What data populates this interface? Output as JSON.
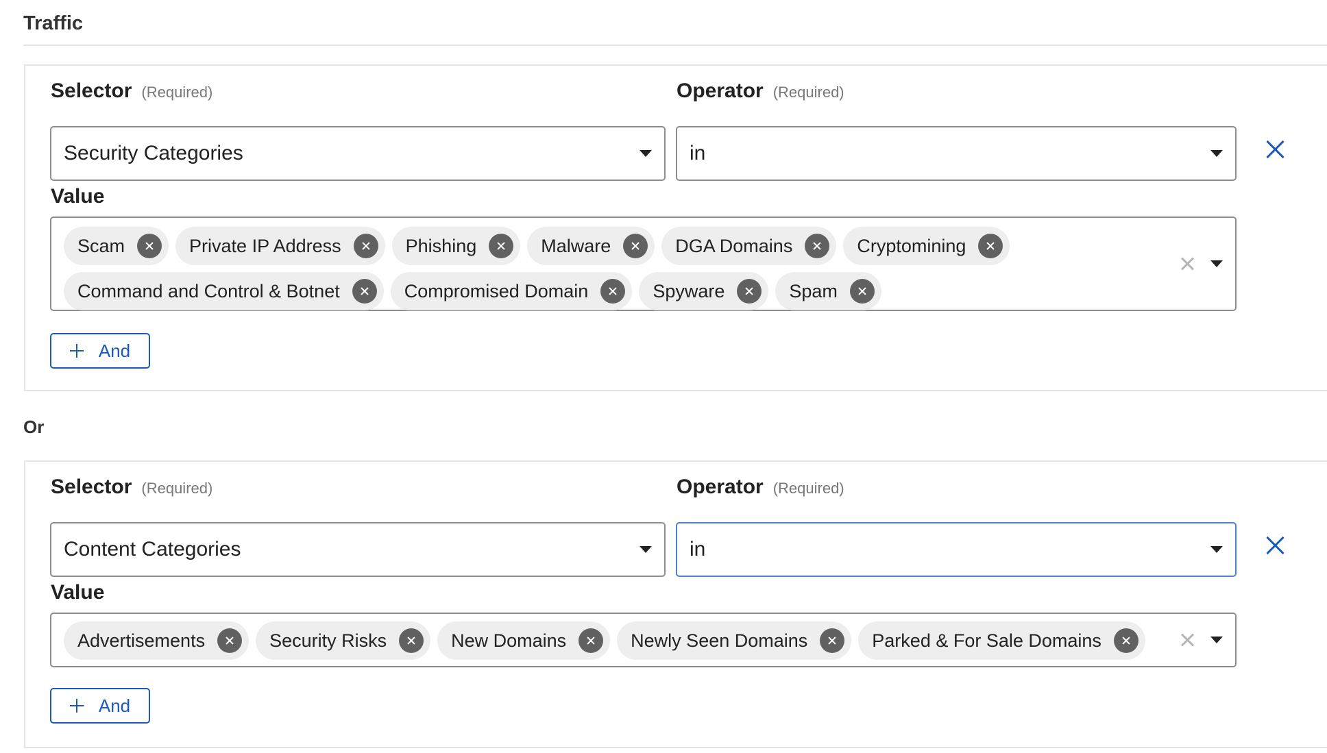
{
  "section": {
    "title": "Traffic"
  },
  "or_label": "Or",
  "rules": [
    {
      "selector": {
        "label": "Selector",
        "required": "(Required)",
        "value": "Security Categories"
      },
      "operator": {
        "label": "Operator",
        "required": "(Required)",
        "value": "in"
      },
      "value": {
        "label": "Value",
        "chips": [
          "Scam",
          "Private IP Address",
          "Phishing",
          "Malware",
          "DGA Domains",
          "Cryptomining",
          "Command and Control & Botnet",
          "Compromised Domain",
          "Spyware",
          "Spam"
        ]
      },
      "and_button": "And"
    },
    {
      "selector": {
        "label": "Selector",
        "required": "(Required)",
        "value": "Content Categories"
      },
      "operator": {
        "label": "Operator",
        "required": "(Required)",
        "value": "in"
      },
      "value": {
        "label": "Value",
        "chips": [
          "Advertisements",
          "Security Risks",
          "New Domains",
          "Newly Seen Domains",
          "Parked & For Sale Domains"
        ]
      },
      "and_button": "And"
    }
  ],
  "colors": {
    "accent": "#1a5ab8",
    "focus_border": "#4a7fd1",
    "chip_bg": "#eeeeee",
    "chip_remove": "#616161"
  }
}
